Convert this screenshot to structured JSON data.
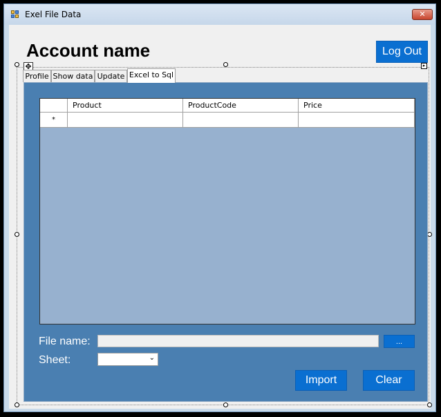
{
  "window": {
    "title": "Exel File Data",
    "close_glyph": "✕"
  },
  "header": {
    "account_name": "Account name",
    "logout_label": "Log Out"
  },
  "tabs": [
    {
      "label": "Profile",
      "active": false
    },
    {
      "label": "Show data",
      "active": false
    },
    {
      "label": "Update",
      "active": false
    },
    {
      "label": "Excel to Sql",
      "active": true
    }
  ],
  "grid": {
    "columns": [
      "Product",
      "ProductCode",
      "Price"
    ],
    "new_row_marker": "*",
    "rows": []
  },
  "form": {
    "file_name_label": "File name:",
    "file_name_value": "",
    "browse_label": "...",
    "sheet_label": "Sheet:",
    "sheet_value": ""
  },
  "actions": {
    "import_label": "Import",
    "clear_label": "Clear"
  },
  "colors": {
    "accent": "#0a6fd1",
    "panel": "#4a7fb1",
    "grid_bg": "#97b1cf"
  },
  "icons": [
    "app-icon",
    "close-icon",
    "move-handle-icon",
    "smart-tag-icon",
    "chevron-down-icon"
  ]
}
